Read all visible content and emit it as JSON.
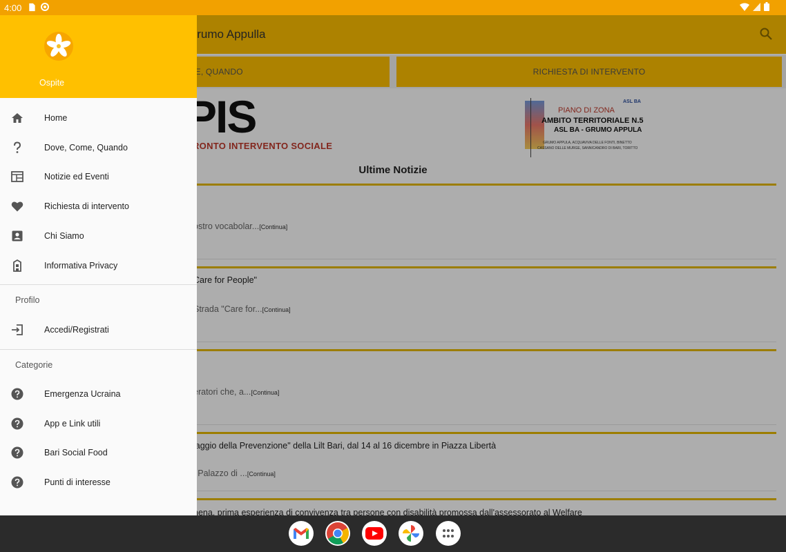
{
  "status_bar": {
    "time": "4:00"
  },
  "app": {
    "title": "Grumo Appulla",
    "tabs": [
      {
        "label": "DOVE, COME, QUANDO"
      },
      {
        "label": "RICHIESTA DI INTERVENTO"
      }
    ],
    "logo_left": {
      "line1": "PIS",
      "line2": "PRONTO INTERVENTO SOCIALE"
    },
    "logo_right": {
      "badge": "ASL BA",
      "line1": "PIANO DI ZONA",
      "line2": "AMBITO TERRITORIALE N.5",
      "line3": "ASL BA - GRUMO APPULA",
      "line4": "GRUMO APPULA, ACQUAVIVA DELLE FONTI, BINETTO",
      "line5": "CASSANO DELLE MURGE, SANNICANDRO DI BARI, TORITTO"
    },
    "news_heading": "Ultime Notizie",
    "news": [
      {
        "title": "",
        "excerpt": "ostro vocabolar...",
        "more": "[Continua]"
      },
      {
        "title": "Care for People\"",
        "excerpt": "Strada \"Care for...",
        "more": "[Continua]"
      },
      {
        "title": "",
        "excerpt": "eratori che, a...",
        "more": "[Continua]"
      },
      {
        "title": "laggio della Prevenzione\" della Lilt Bari, dal 14 al 16 dicembre in Piazza Libertà",
        "excerpt": "i Palazzo di ...",
        "more": "[Continua]"
      },
      {
        "title": "nena, prima esperienza di convivenza tra persone con disabilità promossa dall'assessorato al Welfare",
        "excerpt": "",
        "more": ""
      }
    ]
  },
  "drawer": {
    "user_name": "Ospite",
    "menu": [
      {
        "label": "Home",
        "icon": "home-icon"
      },
      {
        "label": "Dove, Come, Quando",
        "icon": "question-icon"
      },
      {
        "label": "Notizie ed Eventi",
        "icon": "news-icon"
      },
      {
        "label": "Richiesta di intervento",
        "icon": "heart-icon"
      },
      {
        "label": "Chi Siamo",
        "icon": "contact-icon"
      },
      {
        "label": "Informativa Privacy",
        "icon": "privacy-icon"
      }
    ],
    "section_profile": "Profilo",
    "profile_items": [
      {
        "label": "Accedi/Registrati",
        "icon": "login-icon"
      }
    ],
    "section_categories": "Categorie",
    "categories": [
      {
        "label": "Emergenza Ucraina",
        "icon": "help-circle-icon"
      },
      {
        "label": "App e Link utili",
        "icon": "help-circle-icon"
      },
      {
        "label": "Bari Social Food",
        "icon": "help-circle-icon"
      },
      {
        "label": "Punti di interesse",
        "icon": "help-circle-icon"
      }
    ]
  },
  "dock": [
    {
      "name": "gmail-icon"
    },
    {
      "name": "chrome-icon"
    },
    {
      "name": "youtube-icon"
    },
    {
      "name": "photos-icon"
    },
    {
      "name": "app-drawer-icon"
    }
  ],
  "colors": {
    "accent": "#ffc000",
    "status": "#f2a100",
    "navbar": "#2b2b2b"
  }
}
